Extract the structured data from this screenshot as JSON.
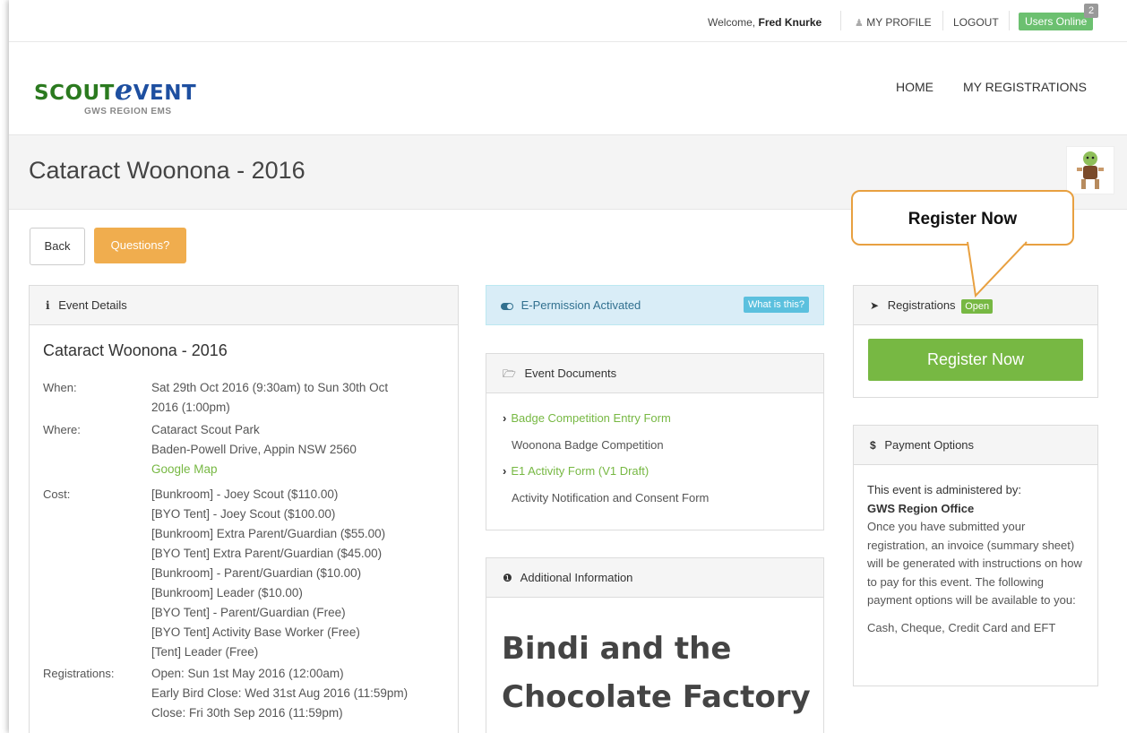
{
  "topbar": {
    "welcome_prefix": "Welcome,",
    "user_name": "Fred Knurke",
    "profile_label": "MY PROFILE",
    "logout_label": "LOGOUT",
    "users_online_label": "Users Online",
    "users_online_count": "2"
  },
  "header": {
    "logo_scout": "SCOUT",
    "logo_e": "e",
    "logo_vent": "VENT",
    "logo_sub": "GWS REGION EMS",
    "nav": {
      "home": "HOME",
      "my_registrations": "MY REGISTRATIONS"
    }
  },
  "page": {
    "title": "Cataract Woonona - 2016",
    "back_label": "Back",
    "questions_label": "Questions?"
  },
  "event_details": {
    "header": "Event Details",
    "title": "Cataract Woonona - 2016",
    "when_label": "When:",
    "when": [
      "Sat 29th Oct 2016 (9:30am) to Sun 30th Oct",
      "2016 (1:00pm)"
    ],
    "where_label": "Where:",
    "where": [
      "Cataract Scout Park",
      "Baden-Powell Drive, Appin NSW 2560"
    ],
    "google_map": "Google Map",
    "cost_label": "Cost:",
    "costs": [
      "[Bunkroom] - Joey Scout ($110.00)",
      "[BYO Tent] - Joey Scout ($100.00)",
      "[Bunkroom] Extra Parent/Guardian ($55.00)",
      "[BYO Tent] Extra Parent/Guardian ($45.00)",
      "[Bunkroom] - Parent/Guardian ($10.00)",
      "[Bunkroom] Leader ($10.00)",
      "[BYO Tent] - Parent/Guardian (Free)",
      "[BYO Tent] Activity Base Worker (Free)",
      "[Tent] Leader (Free)"
    ],
    "registrations_label": "Registrations:",
    "registrations": [
      "Open: Sun 1st May 2016 (12:00am)",
      "Early Bird Close: Wed 31st Aug 2016 (11:59pm)",
      "Close: Fri 30th Sep 2016 (11:59pm)"
    ]
  },
  "epermission": {
    "label": "E-Permission Activated",
    "what_is_this": "What is this?"
  },
  "documents": {
    "header": "Event Documents",
    "items": [
      {
        "link": "Badge Competition Entry Form",
        "desc": "Woonona Badge Competition"
      },
      {
        "link": "E1 Activity Form (V1 Draft)",
        "desc": "Activity Notification and Consent Form"
      }
    ]
  },
  "additional": {
    "header": "Additional Information",
    "big_line1": "Bindi and the",
    "big_line2": "Chocolate Factory"
  },
  "registrations_panel": {
    "header": "Registrations",
    "status": "Open",
    "register_button": "Register Now"
  },
  "payment": {
    "header": "Payment Options",
    "admin_by": "This event is administered by:",
    "org": "GWS Region Office",
    "body": "Once you have submitted your registration, an invoice (summary sheet) will be generated with instructions on how to pay for this event. The following payment options will be available to you:",
    "options": "Cash, Cheque, Credit Card and EFT"
  },
  "callout": {
    "text": "Register Now"
  },
  "colors": {
    "brand_green": "#77b843",
    "questions_orange": "#f0ad4e",
    "info_blue": "#d9edf7",
    "callout_border": "#e8a040"
  }
}
